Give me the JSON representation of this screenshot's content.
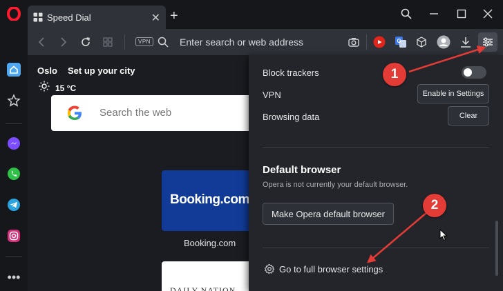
{
  "browser": {
    "tab_title": "Speed Dial",
    "address_placeholder": "Enter search or web address",
    "vpn_badge": "VPN"
  },
  "speed_dial": {
    "city": "Oslo",
    "set_city": "Set up your city",
    "temperature": "15 °C",
    "search_placeholder": "Search the web",
    "tiles": [
      {
        "logo": "Booking.com",
        "label": "Booking.com"
      },
      {
        "logo": "DAILY NATION",
        "label": ""
      }
    ]
  },
  "panel": {
    "block_trackers_label": "Block trackers",
    "block_trackers_on": false,
    "vpn_label": "VPN",
    "vpn_button": "Enable in Settings",
    "browsing_data_label": "Browsing data",
    "clear_button": "Clear",
    "default_heading": "Default browser",
    "default_sub": "Opera is not currently your default browser.",
    "make_default_button": "Make Opera default browser",
    "full_settings_link": "Go to full browser settings"
  },
  "annotations": [
    "1",
    "2"
  ],
  "colors": {
    "opera_red": "#ff1b2d",
    "annotation_red": "#e33b36",
    "booking_blue": "#123b98",
    "sidebar_home": "#4fa7f0"
  }
}
